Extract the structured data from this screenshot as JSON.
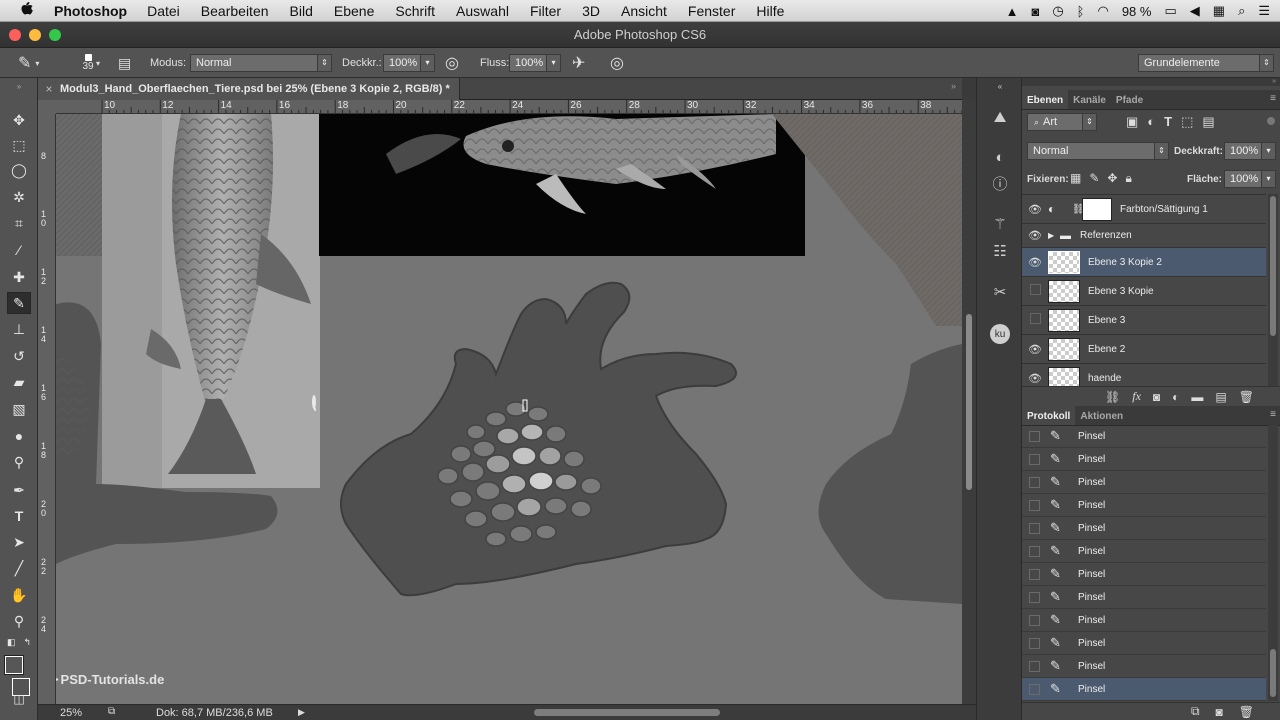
{
  "menubar": {
    "apple": "",
    "app": "Photoshop",
    "items": [
      "Datei",
      "Bearbeiten",
      "Bild",
      "Ebene",
      "Schrift",
      "Auswahl",
      "Filter",
      "3D",
      "Ansicht",
      "Fenster",
      "Hilfe"
    ],
    "battery": "98 %"
  },
  "window": {
    "title": "Adobe Photoshop CS6"
  },
  "options": {
    "brush_size": "39",
    "modus_label": "Modus:",
    "modus_value": "Normal",
    "deckkr_label": "Deckkr.:",
    "deckkr_value": "100%",
    "fluss_label": "Fluss:",
    "fluss_value": "100%",
    "workspace": "Grundelemente"
  },
  "document": {
    "tab_title": "Modul3_Hand_Oberflaechen_Tiere.psd bei 25% (Ebene 3 Kopie 2, RGB/8) *",
    "ruler_h": [
      "10",
      "12",
      "14",
      "16",
      "18",
      "20",
      "22",
      "24",
      "26",
      "28",
      "30",
      "32",
      "34",
      "36",
      "38"
    ],
    "ruler_v": [
      "8",
      "1 0",
      "1 2",
      "1 4",
      "1 6",
      "1 8",
      "2 0",
      "2 2",
      "2 4"
    ],
    "watermark": "PSD-Tutorials.de"
  },
  "status": {
    "zoom": "25%",
    "doc": "Dok: 68,7 MB/236,6 MB"
  },
  "layers_panel": {
    "tabs": [
      "Ebenen",
      "Kanäle",
      "Pfade"
    ],
    "filter": "Art",
    "blend_mode": "Normal",
    "opacity_label": "Deckkraft:",
    "opacity_value": "100%",
    "lock_label": "Fixieren:",
    "fill_label": "Fläche:",
    "fill_value": "100%",
    "layers": [
      {
        "name": "Farbton/Sättigung 1",
        "visible": true
      },
      {
        "name": "Referenzen",
        "visible": true
      },
      {
        "name": "Ebene 3 Kopie 2",
        "visible": true,
        "selected": true
      },
      {
        "name": "Ebene 3 Kopie",
        "visible": false
      },
      {
        "name": "Ebene 3",
        "visible": false
      },
      {
        "name": "Ebene 2",
        "visible": true
      },
      {
        "name": "haende",
        "visible": true
      }
    ]
  },
  "history_panel": {
    "tabs": [
      "Protokoll",
      "Aktionen"
    ],
    "items": [
      "Pinsel",
      "Pinsel",
      "Pinsel",
      "Pinsel",
      "Pinsel",
      "Pinsel",
      "Pinsel",
      "Pinsel",
      "Pinsel",
      "Pinsel",
      "Pinsel",
      "Pinsel"
    ]
  },
  "colors": {
    "selection": "#4b5a6e",
    "canvas_bg": "#757575",
    "panel_bg": "#474747"
  }
}
